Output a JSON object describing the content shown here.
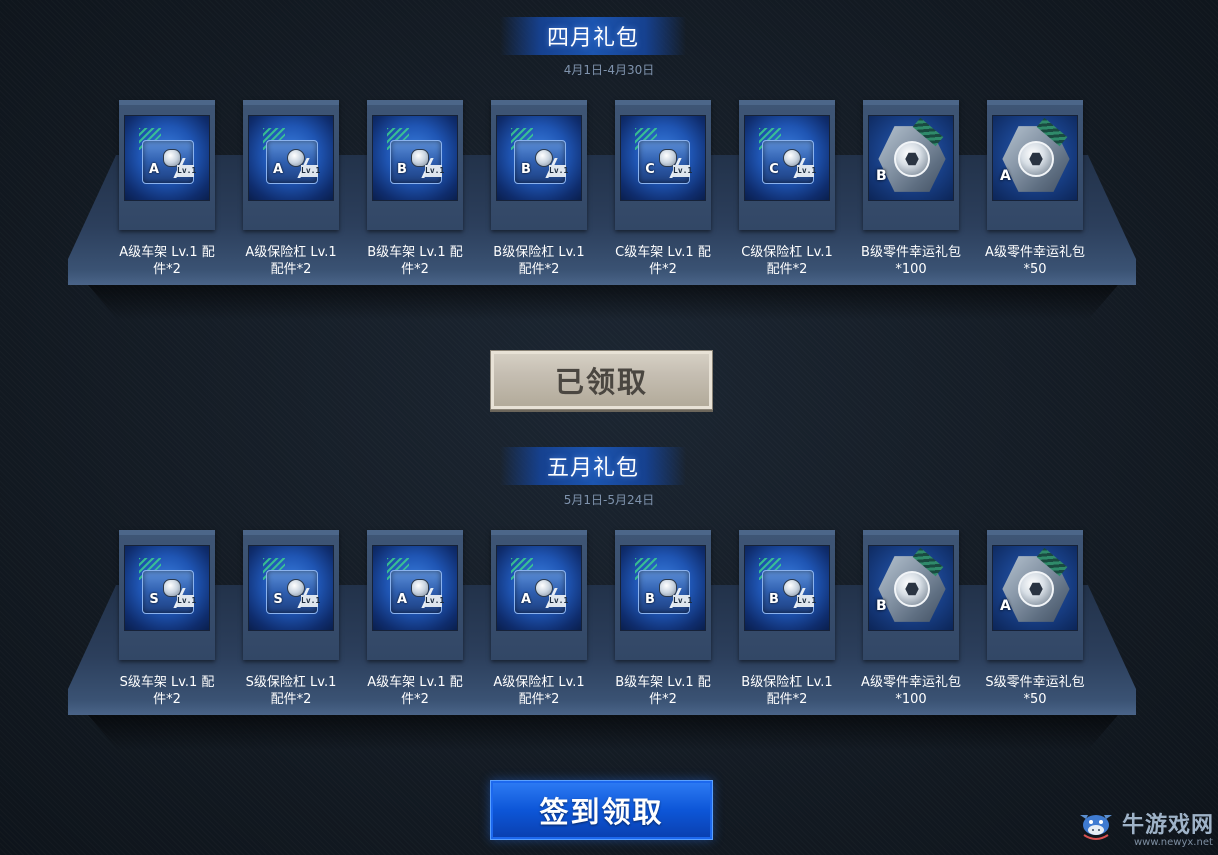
{
  "colors": {
    "background": "#141c26",
    "banner_blue": "#1c55b0",
    "claimed_button": "#c5beb2",
    "sign_button": "#0d56d8",
    "card": "#3e5575"
  },
  "sections": [
    {
      "title": "四月礼包",
      "dates": "4月1日-4月30日",
      "items": [
        {
          "grade": "A",
          "icon": "frame-crate-icon",
          "caption_l1": "A级车架 Lv.1 配",
          "caption_l2": "件*2"
        },
        {
          "grade": "A",
          "icon": "bumper-crate-icon",
          "caption_l1": "A级保险杠 Lv.1",
          "caption_l2": "配件*2"
        },
        {
          "grade": "B",
          "icon": "frame-crate-icon",
          "caption_l1": "B级车架 Lv.1 配",
          "caption_l2": "件*2"
        },
        {
          "grade": "B",
          "icon": "bumper-crate-icon",
          "caption_l1": "B级保险杠 Lv.1",
          "caption_l2": "配件*2"
        },
        {
          "grade": "C",
          "icon": "frame-crate-icon",
          "caption_l1": "C级车架 Lv.1 配",
          "caption_l2": "件*2"
        },
        {
          "grade": "C",
          "icon": "bumper-crate-icon",
          "caption_l1": "C级保险杠 Lv.1",
          "caption_l2": "配件*2"
        },
        {
          "grade": "B",
          "icon": "hex-nut-icon",
          "caption_l1": "B级零件幸运礼包",
          "caption_l2": "*100"
        },
        {
          "grade": "A",
          "icon": "hex-nut-icon",
          "caption_l1": "A级零件幸运礼包",
          "caption_l2": "*50"
        }
      ],
      "button_label": "已领取"
    },
    {
      "title": "五月礼包",
      "dates": "5月1日-5月24日",
      "items": [
        {
          "grade": "S",
          "icon": "frame-crate-icon",
          "caption_l1": "S级车架 Lv.1 配",
          "caption_l2": "件*2"
        },
        {
          "grade": "S",
          "icon": "bumper-crate-icon",
          "caption_l1": "S级保险杠 Lv.1",
          "caption_l2": "配件*2"
        },
        {
          "grade": "A",
          "icon": "frame-crate-icon",
          "caption_l1": "A级车架 Lv.1 配",
          "caption_l2": "件*2"
        },
        {
          "grade": "A",
          "icon": "bumper-crate-icon",
          "caption_l1": "A级保险杠 Lv.1",
          "caption_l2": "配件*2"
        },
        {
          "grade": "B",
          "icon": "frame-crate-icon",
          "caption_l1": "B级车架 Lv.1 配",
          "caption_l2": "件*2"
        },
        {
          "grade": "B",
          "icon": "bumper-crate-icon",
          "caption_l1": "B级保险杠 Lv.1",
          "caption_l2": "配件*2"
        },
        {
          "grade": "B",
          "icon": "hex-nut-icon",
          "caption_l1": "A级零件幸运礼包",
          "caption_l2": "*100"
        },
        {
          "grade": "A",
          "icon": "hex-nut-icon",
          "caption_l1": "S级零件幸运礼包",
          "caption_l2": "*50"
        }
      ],
      "button_label": "签到领取"
    }
  ],
  "lv_tag": "Lv.1",
  "watermark": {
    "name": "牛游戏网",
    "url": "www.newyx.net",
    "icon": "cow-logo-icon"
  }
}
